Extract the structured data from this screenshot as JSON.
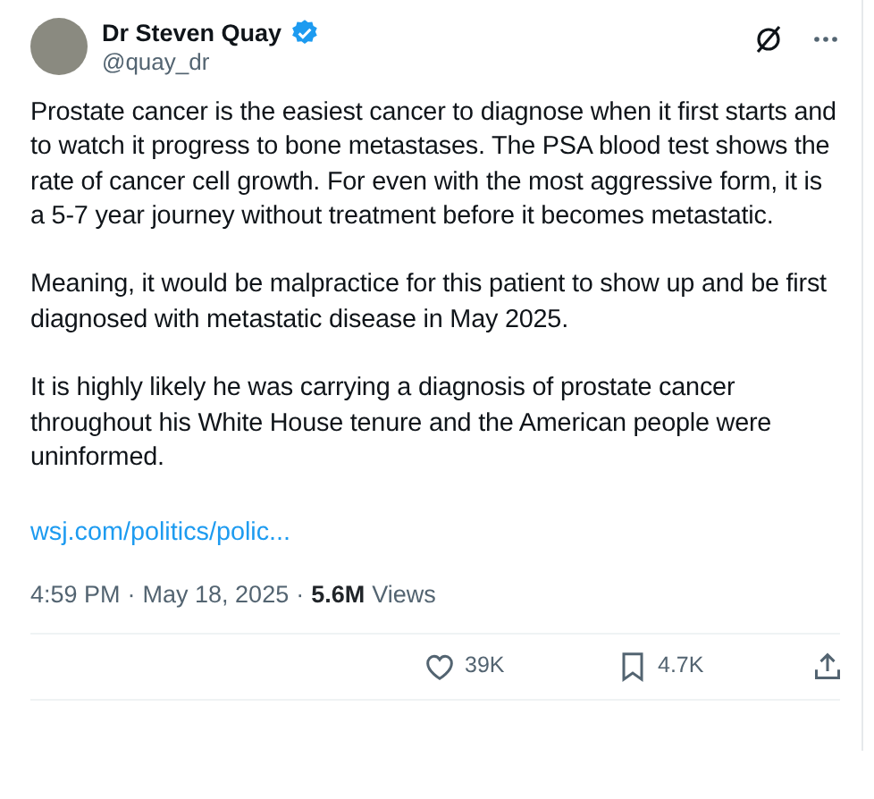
{
  "author": {
    "name": "Dr Steven Quay",
    "verified": true,
    "handle": "@quay_dr"
  },
  "paragraphs": [
    "Prostate cancer is the easiest cancer to diagnose when it first starts and to watch it progress to bone metastases. The PSA blood test shows the rate of cancer cell growth. For even with the most aggressive form, it is a 5-7 year journey without treatment before it becomes metastatic.",
    "Meaning, it would be malpractice for this patient to show up and be first diagnosed with metastatic disease in May 2025.",
    "It is highly likely he was carrying a diagnosis of prostate cancer throughout his White House tenure and the American people were uninformed."
  ],
  "link": "wsj.com/politics/polic...",
  "meta": {
    "time": "4:59 PM",
    "date": "May 18, 2025",
    "separator": "·",
    "views_count": "5.6M",
    "views_label": "Views"
  },
  "actions": [
    {
      "kind": "like",
      "count": "39K"
    },
    {
      "kind": "bookmark",
      "count": "4.7K"
    },
    {
      "kind": "share"
    }
  ]
}
